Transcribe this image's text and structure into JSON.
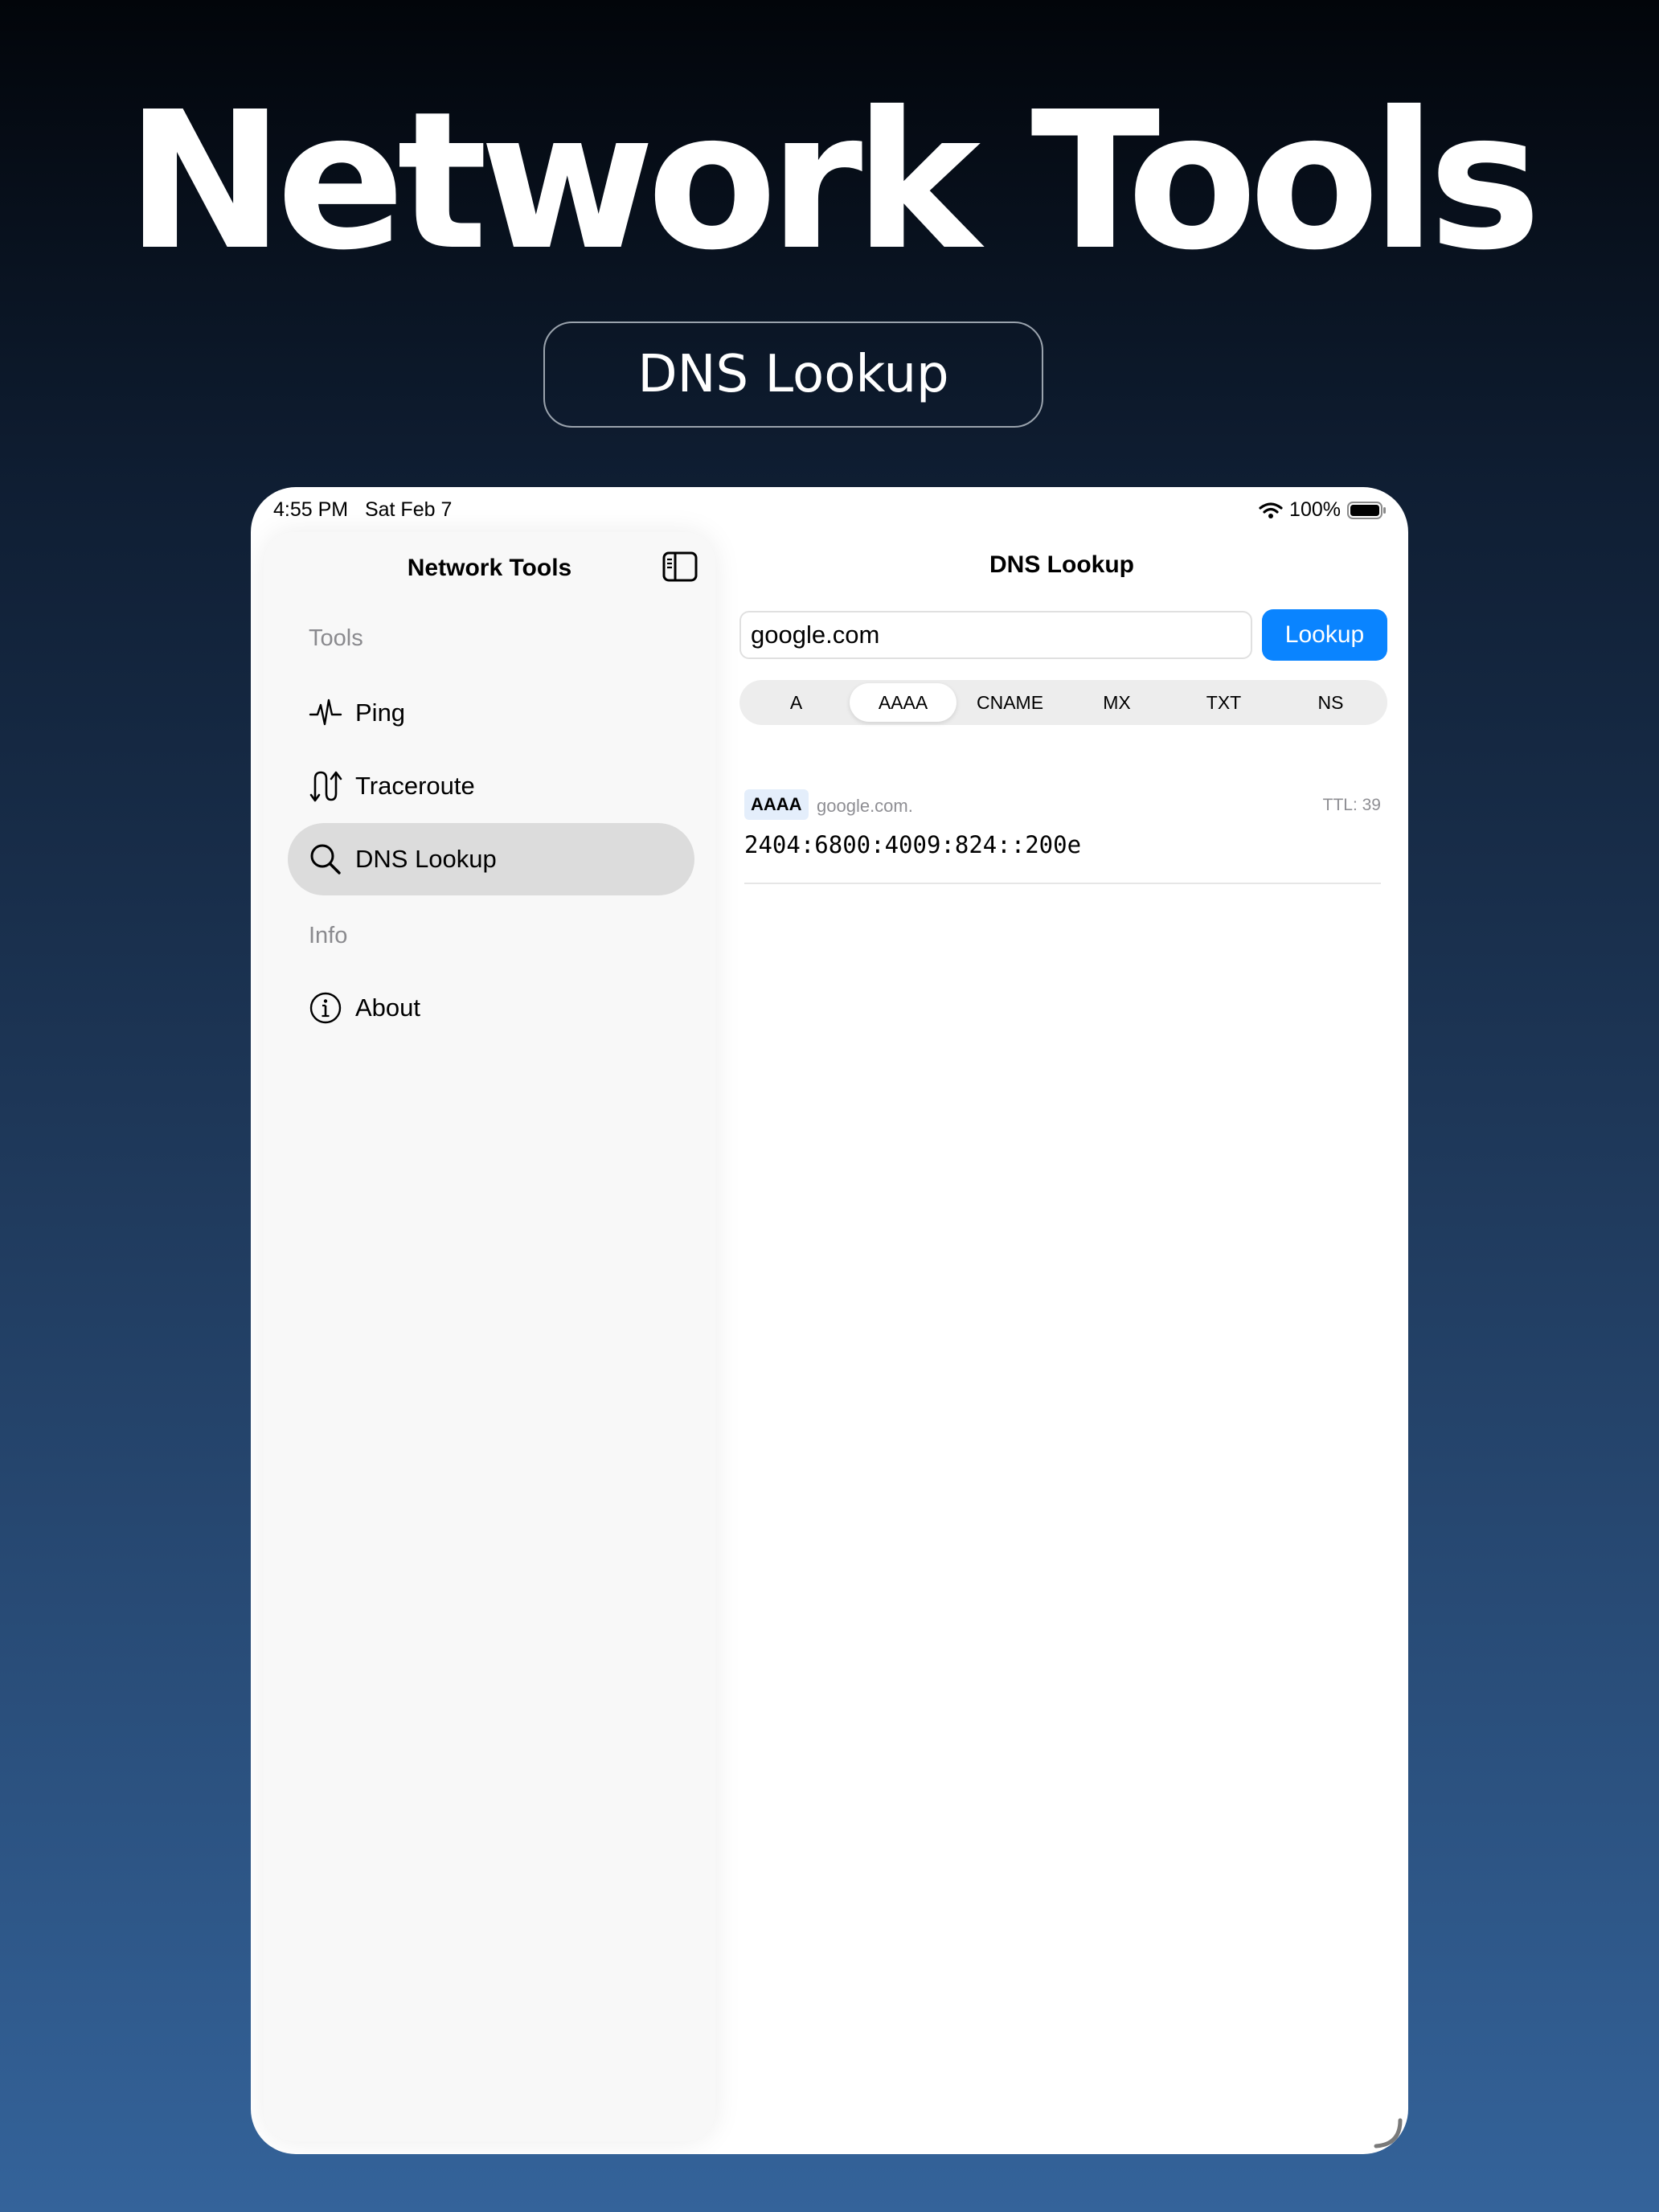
{
  "hero": {
    "title": "Network Tools",
    "badge": "DNS Lookup"
  },
  "status_bar": {
    "time": "4:55 PM",
    "date": "Sat Feb 7",
    "battery": "100%"
  },
  "sidebar": {
    "title": "Network Tools",
    "sections": {
      "tools": "Tools",
      "info": "Info"
    },
    "items": {
      "ping": "Ping",
      "traceroute": "Traceroute",
      "dns": "DNS Lookup",
      "about": "About"
    }
  },
  "detail": {
    "title": "DNS Lookup",
    "input_value": "google.com",
    "lookup_label": "Lookup",
    "record_types": [
      "A",
      "AAAA",
      "CNAME",
      "MX",
      "TXT",
      "NS"
    ],
    "selected_type": "AAAA",
    "result": {
      "type": "AAAA",
      "name": "google.com.",
      "ttl": "TTL: 39",
      "value": "2404:6800:4009:824::200e"
    }
  },
  "colors": {
    "accent": "#0a84ff",
    "selected_row": "#dcdcdc",
    "type_badge": "#e4eefb"
  }
}
